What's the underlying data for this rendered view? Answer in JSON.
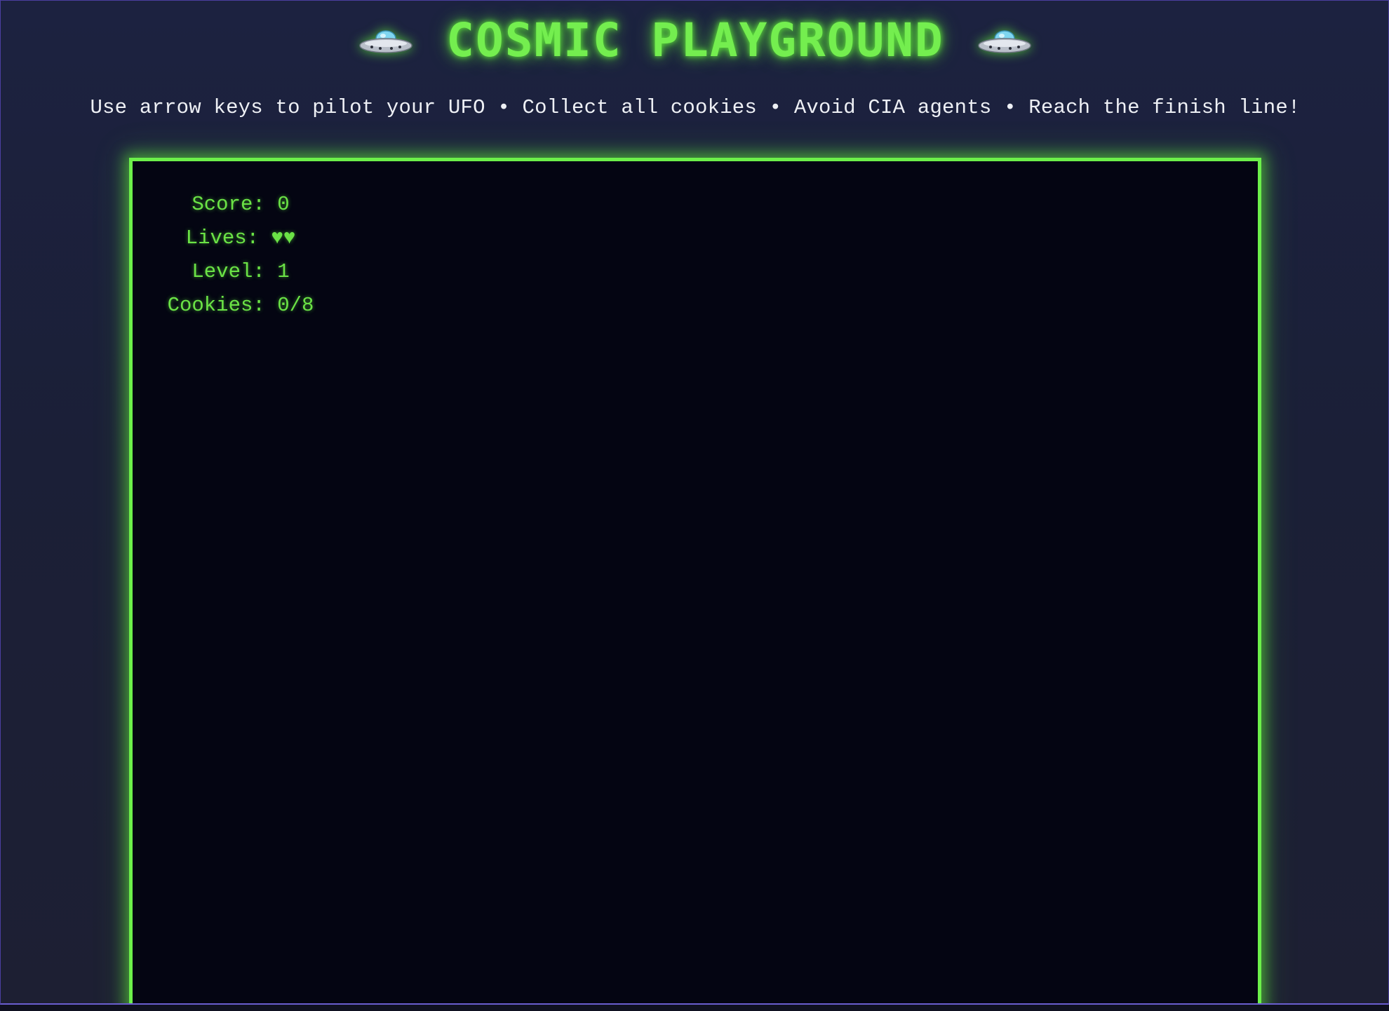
{
  "header": {
    "title": "COSMIC PLAYGROUND",
    "left_icon": "ufo-icon",
    "right_icon": "ufo-icon"
  },
  "instructions": "Use arrow keys to pilot your UFO • Collect all cookies • Avoid CIA agents • Reach the finish line!",
  "hud": {
    "score_label": "Score: ",
    "score": "0",
    "lives_label": "Lives: ",
    "lives": "♥♥",
    "level_label": "Level: ",
    "level": "1",
    "cookies_label": "Cookies: ",
    "cookies": "0/8"
  },
  "colors": {
    "accent": "#6cf04a",
    "background": "#1b1f37",
    "board": "#040512",
    "text": "#eef0f5"
  }
}
